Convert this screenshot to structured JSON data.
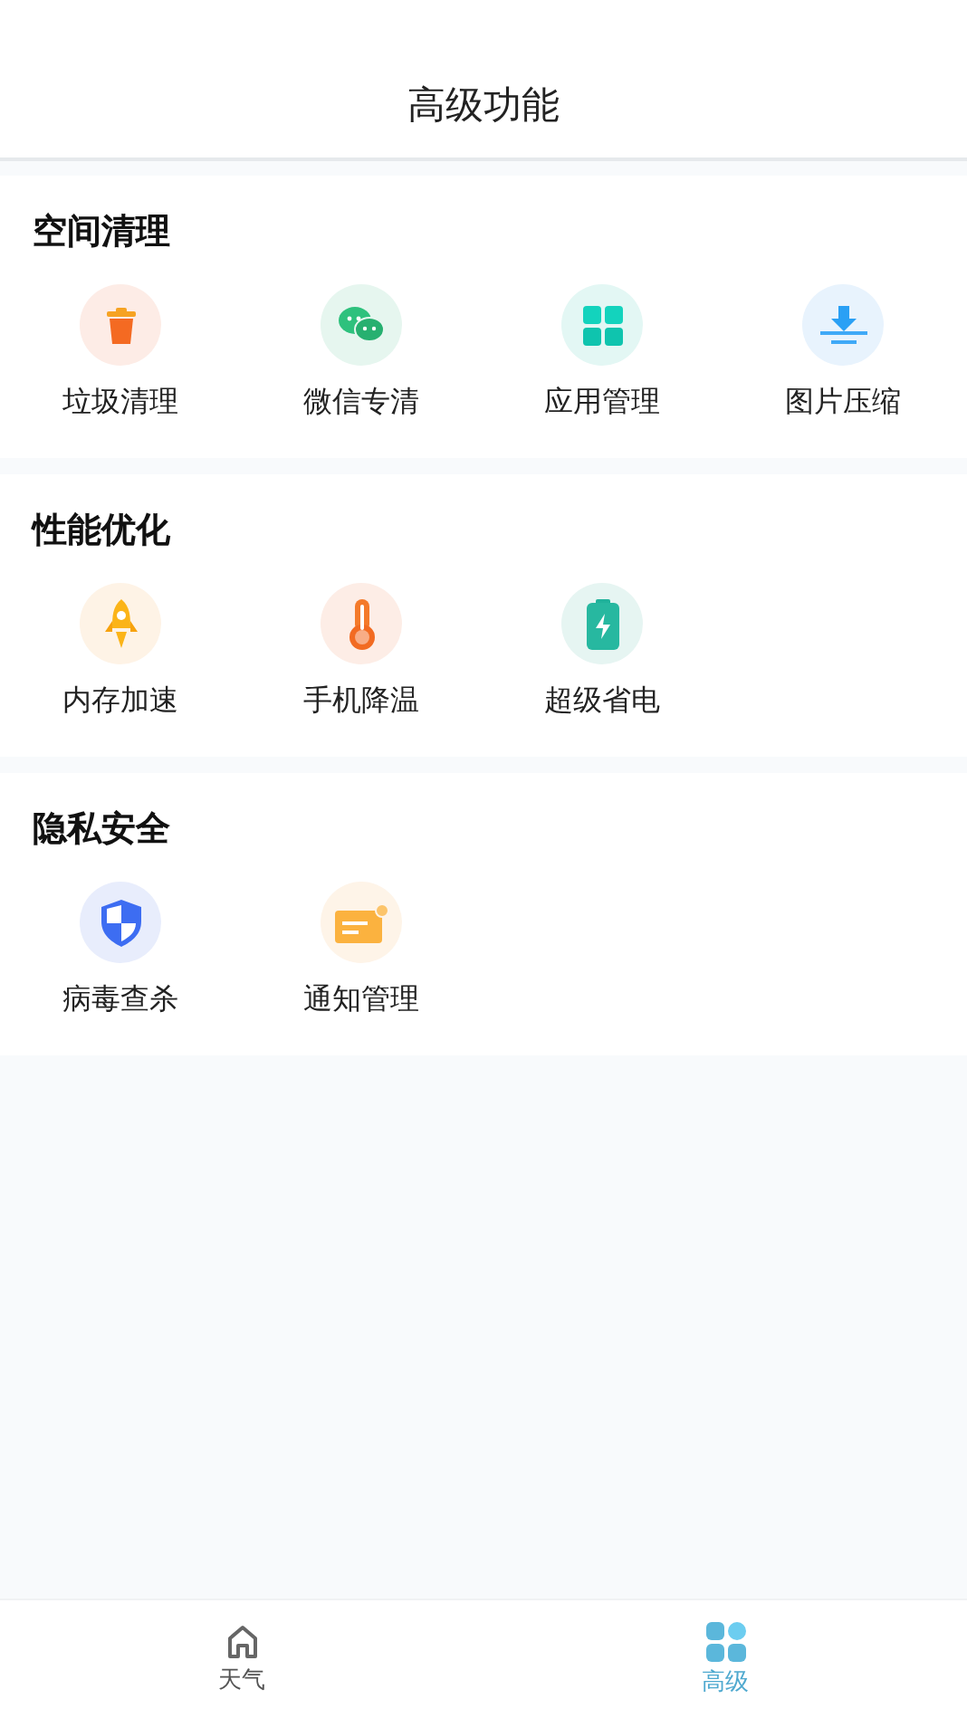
{
  "header": {
    "title": "高级功能"
  },
  "sections": [
    {
      "title": "空间清理",
      "items": [
        {
          "label": "垃圾清理",
          "kind": "trash",
          "color": "#fdece6"
        },
        {
          "label": "微信专清",
          "kind": "chat",
          "color": "#e6f6ef"
        },
        {
          "label": "应用管理",
          "kind": "apps",
          "color": "#e3f7f4"
        },
        {
          "label": "图片压缩",
          "kind": "compress",
          "color": "#e8f3fd"
        }
      ]
    },
    {
      "title": "性能优化",
      "items": [
        {
          "label": "内存加速",
          "kind": "rocket",
          "color": "#fef3e6"
        },
        {
          "label": "手机降温",
          "kind": "thermo",
          "color": "#fdede6"
        },
        {
          "label": "超级省电",
          "kind": "battery",
          "color": "#e6f5f2"
        }
      ]
    },
    {
      "title": "隐私安全",
      "items": [
        {
          "label": "病毒查杀",
          "kind": "shield",
          "color": "#e8edfc"
        },
        {
          "label": "通知管理",
          "kind": "notice",
          "color": "#fef4e8"
        }
      ]
    }
  ],
  "tabs": [
    {
      "label": "天气",
      "kind": "home",
      "selected": false
    },
    {
      "label": "高级",
      "kind": "grid",
      "selected": true
    }
  ]
}
